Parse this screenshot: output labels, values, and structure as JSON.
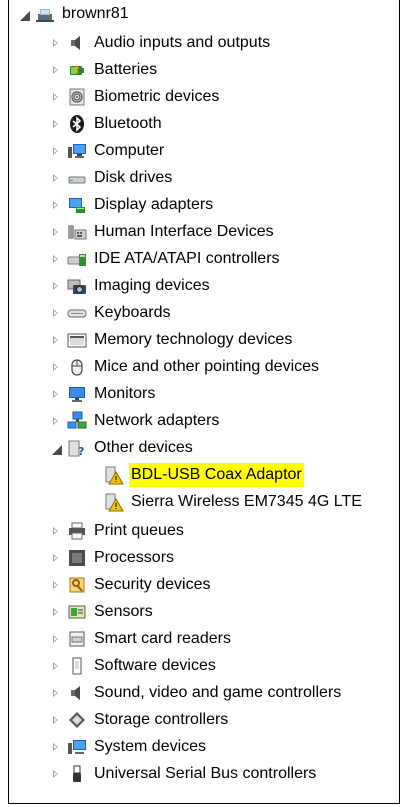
{
  "tree": {
    "root": "brownr81",
    "items": [
      {
        "label": "Audio inputs and outputs",
        "icon": "speaker-icon"
      },
      {
        "label": "Batteries",
        "icon": "battery-icon"
      },
      {
        "label": "Biometric devices",
        "icon": "fingerprint-icon"
      },
      {
        "label": "Bluetooth",
        "icon": "bluetooth-icon"
      },
      {
        "label": "Computer",
        "icon": "computer-icon"
      },
      {
        "label": "Disk drives",
        "icon": "disk-drive-icon"
      },
      {
        "label": "Display adapters",
        "icon": "display-adapter-icon"
      },
      {
        "label": "Human Interface Devices",
        "icon": "hid-icon"
      },
      {
        "label": "IDE ATA/ATAPI controllers",
        "icon": "ide-controller-icon"
      },
      {
        "label": "Imaging devices",
        "icon": "camera-icon"
      },
      {
        "label": "Keyboards",
        "icon": "keyboard-icon"
      },
      {
        "label": "Memory technology devices",
        "icon": "memory-icon"
      },
      {
        "label": "Mice and other pointing devices",
        "icon": "mouse-icon"
      },
      {
        "label": "Monitors",
        "icon": "monitor-icon"
      },
      {
        "label": "Network adapters",
        "icon": "network-adapter-icon"
      },
      {
        "label": "Other devices",
        "icon": "unknown-device-icon",
        "children": [
          {
            "label": "BDL-USB Coax Adaptor",
            "icon": "warning-device-icon",
            "highlighted": true
          },
          {
            "label": "Sierra Wireless EM7345 4G LTE",
            "icon": "warning-device-icon"
          }
        ]
      },
      {
        "label": "Print queues",
        "icon": "printer-icon"
      },
      {
        "label": "Processors",
        "icon": "processor-icon"
      },
      {
        "label": "Security devices",
        "icon": "security-key-icon"
      },
      {
        "label": "Sensors",
        "icon": "sensor-icon"
      },
      {
        "label": "Smart card readers",
        "icon": "smart-card-reader-icon"
      },
      {
        "label": "Software devices",
        "icon": "software-device-icon"
      },
      {
        "label": "Sound, video and game controllers",
        "icon": "sound-video-icon"
      },
      {
        "label": "Storage controllers",
        "icon": "storage-controller-icon"
      },
      {
        "label": "System devices",
        "icon": "system-device-icon"
      },
      {
        "label": "Universal Serial Bus controllers",
        "icon": "usb-icon"
      }
    ]
  },
  "colors": {
    "highlight": "#ffff00",
    "toggle": "#9b9b9b"
  }
}
